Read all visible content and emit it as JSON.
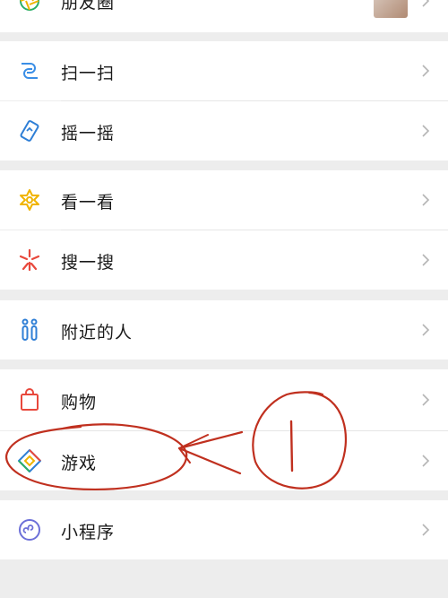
{
  "menu": {
    "moments": {
      "label": "朋友圈",
      "icon": "moments-icon"
    },
    "scan": {
      "label": "扫一扫",
      "icon": "scan-icon"
    },
    "shake": {
      "label": "摇一摇",
      "icon": "shake-icon"
    },
    "top_stories": {
      "label": "看一看",
      "icon": "top-stories-icon"
    },
    "search": {
      "label": "搜一搜",
      "icon": "search-icon"
    },
    "nearby": {
      "label": "附近的人",
      "icon": "people-nearby-icon"
    },
    "shopping": {
      "label": "购物",
      "icon": "shopping-bag-icon"
    },
    "games": {
      "label": "游戏",
      "icon": "games-icon"
    },
    "mini_programs": {
      "label": "小程序",
      "icon": "mini-programs-icon"
    }
  },
  "colors": {
    "background": "#ededed",
    "row": "#ffffff",
    "scan_icon": "#3a8ee6",
    "top_stories_icon": "#f0b400",
    "search_icon": "#e8483c",
    "nearby_icon": "#2f7fd6",
    "shopping_icon": "#e8483c",
    "annotation": "#c0301f"
  }
}
